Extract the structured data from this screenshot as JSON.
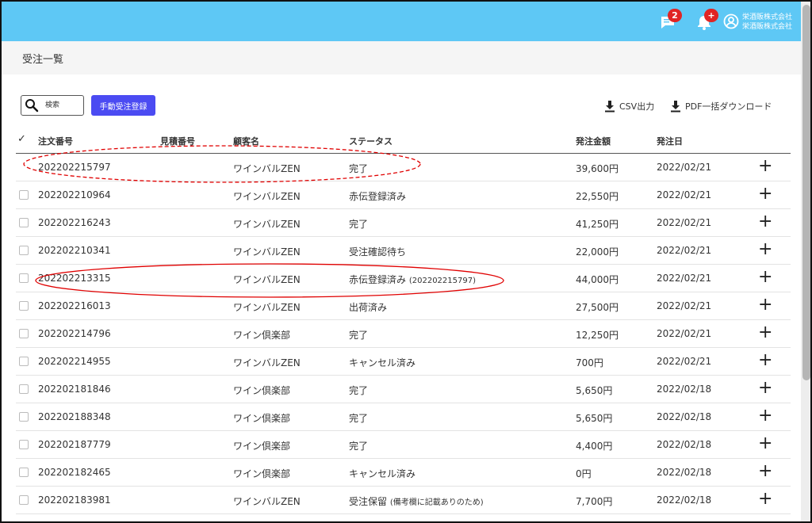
{
  "header": {
    "chat_badge": "2",
    "bell_badge": "+",
    "company_line1": "栄酒販株式会社",
    "company_line2": "栄酒販株式会社"
  },
  "page": {
    "title": "受注一覧"
  },
  "toolbar": {
    "search_placeholder": "検索",
    "manual_order_label": "手動受注登録",
    "csv_label": "CSV出力",
    "pdf_label": "PDF一括ダウンロード"
  },
  "table": {
    "check_header": "✓",
    "columns": {
      "order_no": "注文番号",
      "estimate_no": "見積番号",
      "customer": "顧客名",
      "status": "ステータス",
      "amount": "発注金額",
      "date": "発注日"
    },
    "rows": [
      {
        "order_no": "202202215797",
        "estimate_no": "",
        "customer": "ワインバルZEN",
        "status": "完了",
        "status_note": "",
        "amount": "39,600円",
        "date": "2022/02/21"
      },
      {
        "order_no": "202202210964",
        "estimate_no": "",
        "customer": "ワインバルZEN",
        "status": "赤伝登録済み",
        "status_note": "",
        "amount": "22,550円",
        "date": "2022/02/21"
      },
      {
        "order_no": "202202216243",
        "estimate_no": "",
        "customer": "ワインバルZEN",
        "status": "完了",
        "status_note": "",
        "amount": "41,250円",
        "date": "2022/02/21"
      },
      {
        "order_no": "202202210341",
        "estimate_no": "",
        "customer": "ワインバルZEN",
        "status": "受注確認待ち",
        "status_note": "",
        "amount": "22,000円",
        "date": "2022/02/21"
      },
      {
        "order_no": "202202213315",
        "estimate_no": "",
        "customer": "ワインバルZEN",
        "status": "赤伝登録済み",
        "status_note": "(202202215797)",
        "amount": "44,000円",
        "date": "2022/02/21"
      },
      {
        "order_no": "202202216013",
        "estimate_no": "",
        "customer": "ワインバルZEN",
        "status": "出荷済み",
        "status_note": "",
        "amount": "27,500円",
        "date": "2022/02/21"
      },
      {
        "order_no": "202202214796",
        "estimate_no": "",
        "customer": "ワイン倶楽部",
        "status": "完了",
        "status_note": "",
        "amount": "12,250円",
        "date": "2022/02/21"
      },
      {
        "order_no": "202202214955",
        "estimate_no": "",
        "customer": "ワインバルZEN",
        "status": "キャンセル済み",
        "status_note": "",
        "amount": "700円",
        "date": "2022/02/21"
      },
      {
        "order_no": "202202181846",
        "estimate_no": "",
        "customer": "ワイン倶楽部",
        "status": "完了",
        "status_note": "",
        "amount": "5,650円",
        "date": "2022/02/18"
      },
      {
        "order_no": "202202188348",
        "estimate_no": "",
        "customer": "ワイン倶楽部",
        "status": "完了",
        "status_note": "",
        "amount": "5,650円",
        "date": "2022/02/18"
      },
      {
        "order_no": "202202187779",
        "estimate_no": "",
        "customer": "ワイン倶楽部",
        "status": "完了",
        "status_note": "",
        "amount": "4,400円",
        "date": "2022/02/18"
      },
      {
        "order_no": "202202182465",
        "estimate_no": "",
        "customer": "ワイン倶楽部",
        "status": "キャンセル済み",
        "status_note": "",
        "amount": "0円",
        "date": "2022/02/18"
      },
      {
        "order_no": "202202183981",
        "estimate_no": "",
        "customer": "ワインバルZEN",
        "status": "受注保留",
        "status_note": "(備考欄に記載ありのため)",
        "amount": "7,700円",
        "date": "2022/02/18"
      }
    ],
    "expand_symbol": "+"
  },
  "colors": {
    "header_bg": "#5ec8f5",
    "primary_button": "#4b4bf2",
    "badge": "#e02424",
    "annotation": "#e00000"
  },
  "icons": {
    "chat": "chat-icon",
    "bell": "bell-icon",
    "user": "user-circle-icon",
    "search": "search-icon",
    "download": "download-icon",
    "expand": "plus-icon"
  }
}
